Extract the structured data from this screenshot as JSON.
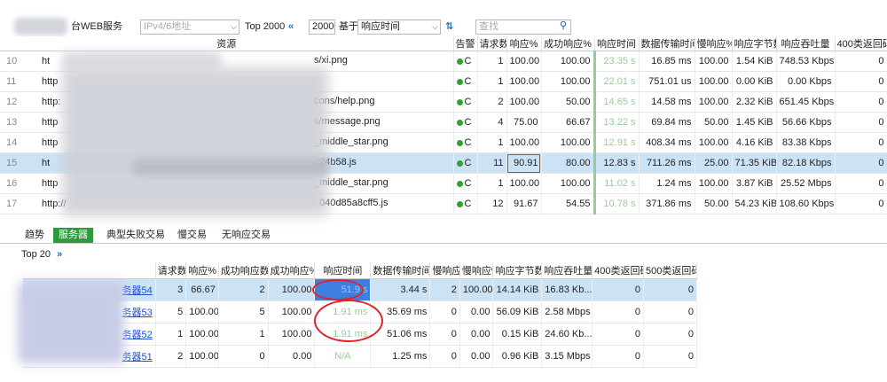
{
  "toolbar": {
    "scope_label": "台WEB服务",
    "ip_placeholder": "IPv4/6地址",
    "topn": "Top 2000",
    "rewind_icon": "«",
    "count": "2000",
    "basis_label": "基于",
    "sort_field": "响应时间",
    "search_placeholder": "查找"
  },
  "main_table": {
    "columns": [
      "资源",
      "告警",
      "请求数",
      "响应%",
      "成功响应%",
      "响应时间",
      "数据传输时间",
      "慢响应%",
      "响应字节数",
      "响应吞吐量",
      "400类返回码"
    ],
    "rows": [
      {
        "idx": "10",
        "res_pre": "ht",
        "res_suf": "s/xi.png",
        "alarm": "C",
        "req": "1",
        "resp": "100.00",
        "ok": "100.00",
        "rt": "23.35 s",
        "rt_green": true,
        "xfer": "16.85 ms",
        "slow": "100.00",
        "bytes": "1.54 KiB",
        "tput": "748.53 Kbps",
        "c400": "0"
      },
      {
        "idx": "11",
        "res_pre": "http",
        "res_suf": "",
        "alarm": "C",
        "req": "1",
        "resp": "100.00",
        "ok": "100.00",
        "rt": "22.01 s",
        "rt_green": true,
        "xfer": "751.01 us",
        "slow": "100.00",
        "bytes": "0.00 KiB",
        "tput": "0.00 Kbps",
        "c400": "0"
      },
      {
        "idx": "12",
        "res_pre": "http:",
        "res_suf": "cons/help.png",
        "alarm": "C",
        "req": "2",
        "resp": "100.00",
        "ok": "50.00",
        "rt": "14.65 s",
        "rt_green": true,
        "xfer": "14.58 ms",
        "slow": "100.00",
        "bytes": "2.32 KiB",
        "tput": "651.45 Kbps",
        "c400": "0"
      },
      {
        "idx": "13",
        "res_pre": "http",
        "res_suf": "s/message.png",
        "alarm": "C",
        "req": "4",
        "resp": "75.00",
        "ok": "66.67",
        "rt": "13.22 s",
        "rt_green": true,
        "xfer": "69.84 ms",
        "slow": "50.00",
        "bytes": "1.45 KiB",
        "tput": "56.66 Kbps",
        "c400": "0"
      },
      {
        "idx": "14",
        "res_pre": "http",
        "res_suf": "_middle_star.png",
        "alarm": "C",
        "req": "1",
        "resp": "100.00",
        "ok": "100.00",
        "rt": "12.91 s",
        "rt_green": true,
        "xfer": "408.34 ms",
        "slow": "100.00",
        "bytes": "4.16 KiB",
        "tput": "83.38 Kbps",
        "c400": "0"
      },
      {
        "idx": "15",
        "res_pre": "ht",
        "res_suf": "224b58.js",
        "alarm": "C",
        "req": "11",
        "resp": "90.91",
        "ok": "80.00",
        "rt": "12.83 s",
        "rt_green": false,
        "xfer": "711.26 ms",
        "slow": "25.00",
        "bytes": "71.35 KiB",
        "tput": "82.18 Kbps",
        "c400": "0"
      },
      {
        "idx": "16",
        "res_pre": "http",
        "res_suf": "_middle_star.png",
        "alarm": "C",
        "req": "1",
        "resp": "100.00",
        "ok": "100.00",
        "rt": "11.02 s",
        "rt_green": true,
        "xfer": "1.24 ms",
        "slow": "100.00",
        "bytes": "3.87 KiB",
        "tput": "25.52 Mbps",
        "c400": "0"
      },
      {
        "idx": "17",
        "res_pre": "http://",
        "res_suf": "040d85a8cff5.js",
        "alarm": "C",
        "req": "12",
        "resp": "91.67",
        "ok": "54.55",
        "rt": "10.78 s",
        "rt_green": true,
        "xfer": "371.86 ms",
        "slow": "50.00",
        "bytes": "54.23 KiB",
        "tput": "108.60 Kbps",
        "c400": "0"
      }
    ]
  },
  "tabs": [
    "趋势",
    "服务器",
    "典型失败交易",
    "慢交易",
    "无响应交易"
  ],
  "lower": {
    "top_label": "Top 20",
    "more_icon": "»",
    "columns": [
      "请求数",
      "响应%",
      "成功响应数",
      "成功响应%",
      "响应时间",
      "数据传输时间",
      "慢响应",
      "慢响应%",
      "响应字节数",
      "响应吞吐量",
      "400类返回码",
      "500类返回码"
    ],
    "rows": [
      {
        "name": "务器54",
        "req": "3",
        "resp": "66.67",
        "okn": "2",
        "okp": "100.00",
        "rt": "51.9 s",
        "xfer": "3.44 s",
        "slown": "2",
        "slowp": "100.00",
        "bytes": "14.14 KiB",
        "tput": "16.83 Kb...",
        "c400": "0",
        "c500": "0"
      },
      {
        "name": "务器53",
        "req": "5",
        "resp": "100.00",
        "okn": "5",
        "okp": "100.00",
        "rt": "1.91 ms",
        "xfer": "35.69 ms",
        "slown": "0",
        "slowp": "0.00",
        "bytes": "56.09 KiB",
        "tput": "2.58 Mbps",
        "c400": "0",
        "c500": "0"
      },
      {
        "name": "务器52",
        "req": "1",
        "resp": "100.00",
        "okn": "1",
        "okp": "100.00",
        "rt": "1.91 ms",
        "xfer": "51.06 ms",
        "slown": "0",
        "slowp": "0.00",
        "bytes": "0.15 KiB",
        "tput": "24.60 Kb...",
        "c400": "0",
        "c500": "0"
      },
      {
        "name": "务器51",
        "req": "2",
        "resp": "100.00",
        "okn": "0",
        "okp": "0.00",
        "rt": "N/A",
        "xfer": "1.25 ms",
        "slown": "0",
        "slowp": "0.00",
        "bytes": "0.96 KiB",
        "tput": "3.15 Mbps",
        "c400": "0",
        "c500": "0"
      }
    ]
  }
}
